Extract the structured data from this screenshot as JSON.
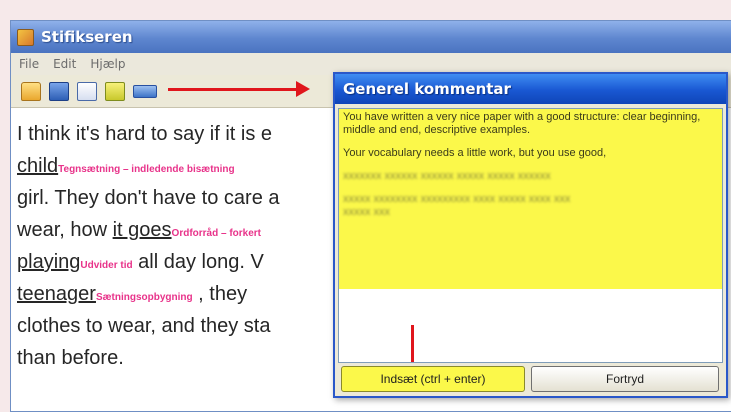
{
  "app": {
    "title": "Stifikseren",
    "menu": [
      "File",
      "Edit",
      "Hjælp"
    ]
  },
  "toolbar": {
    "icons": [
      "folder-open-icon",
      "save-icon",
      "edit-icon",
      "comment-icon",
      "panel-icon"
    ]
  },
  "document": {
    "line1": "I think it's hard to say if it is e",
    "line2_word": "child",
    "line2_comment": "Tegnsætning – indledende bisætning",
    "line3": "girl. They don't have to care a",
    "line4_pre": "wear, how ",
    "line4_word": "it goes",
    "line4_comment": "Ordforråd – forkert",
    "line5_word": "playing",
    "line5_comment": "Udvider tid",
    "line5_post": "  all day long. V",
    "line6_word": "teenager",
    "line6_comment": "Sætningsopbygning",
    "line6_post": " , they",
    "line7": "clothes to wear, and they sta",
    "line8": "than before."
  },
  "dialog": {
    "title": "Generel kommentar",
    "comment_p1": "You have written a very nice paper with a good structure: clear beginning, middle and end, descriptive examples.",
    "comment_p2": "Your vocabulary needs a little work, but you use good,",
    "insert_label": "Indsæt (ctrl + enter)",
    "cancel_label": "Fortryd"
  },
  "colors": {
    "highlight": "#fbf84a",
    "annotation": "#e8338a",
    "arrow": "#e0161c",
    "dialog_title": "#1957d2"
  }
}
